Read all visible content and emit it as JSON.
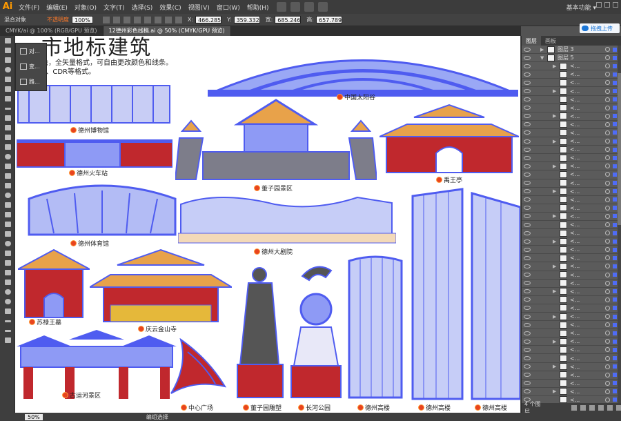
{
  "app": {
    "logo": "Ai",
    "workspace": "基本功能 ▾"
  },
  "menus": [
    "文件(F)",
    "编辑(E)",
    "对象(O)",
    "文字(T)",
    "选择(S)",
    "效果(C)",
    "视图(V)",
    "窗口(W)",
    "帮助(H)"
  ],
  "control_bar": {
    "selection_label": "混合对象",
    "opacity_label": "不透明度",
    "opacity_value": "100%",
    "x_label": "X:",
    "x_value": "466.285",
    "y_label": "Y:",
    "y_value": "359.332",
    "w_label": "宽:",
    "w_value": "685.246",
    "h_label": "高:",
    "h_value": "657.789"
  },
  "tabs": [
    {
      "label": "CMYK/ai @ 100% (RGB/GPU 预览)",
      "active": false
    },
    {
      "label": "12德州彩色线稿.ai @ 50% (CMYK/GPU 预览)",
      "active": true
    }
  ],
  "upload_button": "拖拽上传",
  "flyout": {
    "items": [
      "对...",
      "变...",
      "路..."
    ]
  },
  "canvas": {
    "heading": "市地标建筑",
    "description_line1": "绘，全矢量格式，可自由更改颜色和线条。",
    "description_line2": "S、CDR等格式。",
    "labels": {
      "taiyanggu": "中国太阳谷",
      "bowuguan": "德州博物馆",
      "huochezhan": "德州火车站",
      "dongziyuan": "董子园景区",
      "yuwangting": "禹王亭",
      "tiyuguan": "德州体育馆",
      "dajuyuan": "德州大剧院",
      "suluwangmu": "苏禄王墓",
      "qingyunsi": "庆云金山寺",
      "yunhe": "古运河景区",
      "guangchang": "中心广场",
      "diaosu": "董子园雕塑",
      "changhe": "长河公园",
      "gaolou1": "德州高楼",
      "gaolou2": "德州高楼",
      "gaolou3": "德州高楼"
    }
  },
  "colors": {
    "accent_blue": "#4f5cf0",
    "roof_orange": "#e8a24a",
    "wall_red": "#c0282d",
    "label_dot": "#e8441f"
  },
  "layers_panel": {
    "tabs": [
      "图层",
      "画板"
    ],
    "top_layers": [
      "图层 3",
      "图层 5"
    ],
    "sub_items": [
      "<...",
      "<...",
      "<...",
      "<...",
      "<...",
      "<...",
      "<...",
      "<...",
      "<...",
      "<...",
      "<...",
      "<...",
      "<...",
      "<...",
      "<...",
      "<...",
      "<...",
      "<...",
      "<...",
      "<...",
      "<...",
      "<...",
      "<...",
      "<...",
      "<...",
      "<...",
      "<...",
      "<...",
      "<...",
      "<...",
      "<...",
      "<...",
      "<...",
      "<...",
      "<...",
      "<...",
      "<...",
      "<...",
      "<...",
      "<...",
      "<..."
    ],
    "footer_count": "4 个图层"
  },
  "status_bar": {
    "zoom": "50%",
    "tool": "编组选择"
  }
}
